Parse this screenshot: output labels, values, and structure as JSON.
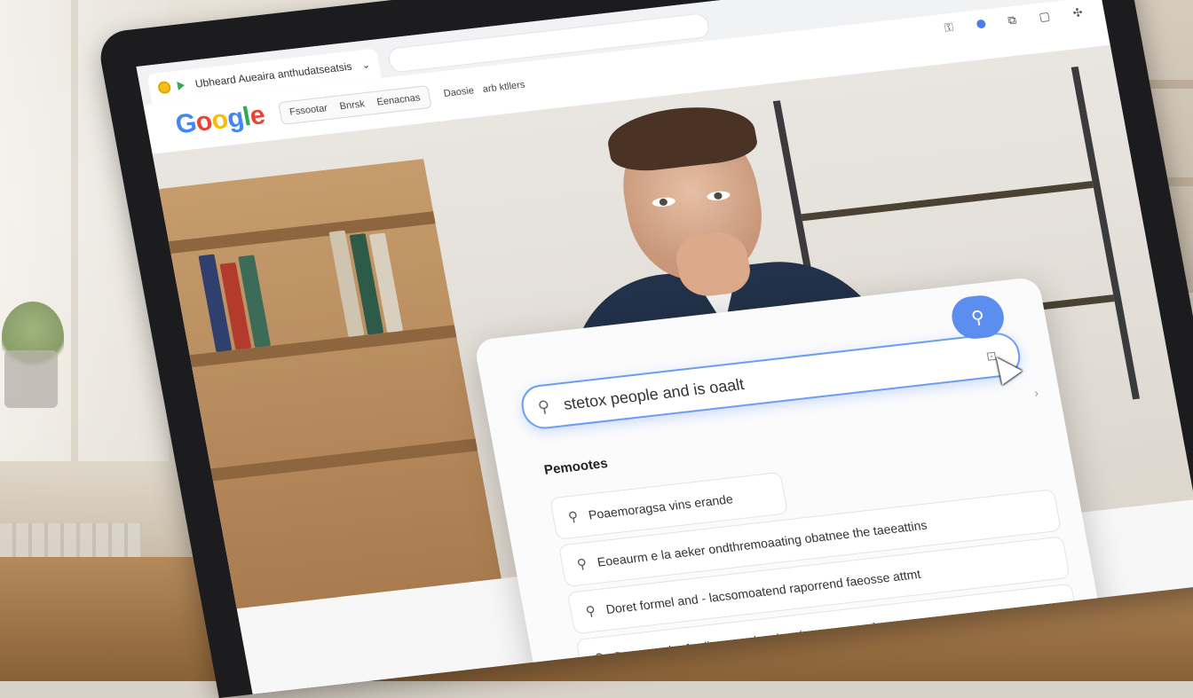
{
  "browser": {
    "tab_title": "Ubheard Aueaira anthudatseatsis",
    "window_controls": [
      "≡",
      "—",
      "◯",
      "▢",
      "✕"
    ],
    "toolbar_icons": [
      "key-icon",
      "profile-icon",
      "screenshot-icon",
      "square-icon",
      "extensions-icon"
    ]
  },
  "nav": {
    "logo_letters": [
      "G",
      "o",
      "o",
      "g",
      "l",
      "e"
    ],
    "boxed_links": [
      "Fssootar",
      "Bnrsk",
      "Eenacnas"
    ],
    "plain_links": [
      "Daosie",
      "arb ktllers"
    ]
  },
  "search": {
    "query": "stetox people and is oaalt",
    "search_button_label": "Search",
    "suggestions_heading": "Pemootes",
    "suggestions": [
      "Poaemoragsa vins erande",
      "Eoeaurm e la aeker ondthremoaating obatnee the taeeattins",
      "Doret formel and - lacsomoatend raporrend faeosse attmt",
      "Deoruma be fordion ceoplensine the oeenene dengeret oacop"
    ]
  },
  "colors": {
    "accent": "#4285f4",
    "search_button": "#5c8ef0",
    "bezel": "#1c1c1e"
  }
}
